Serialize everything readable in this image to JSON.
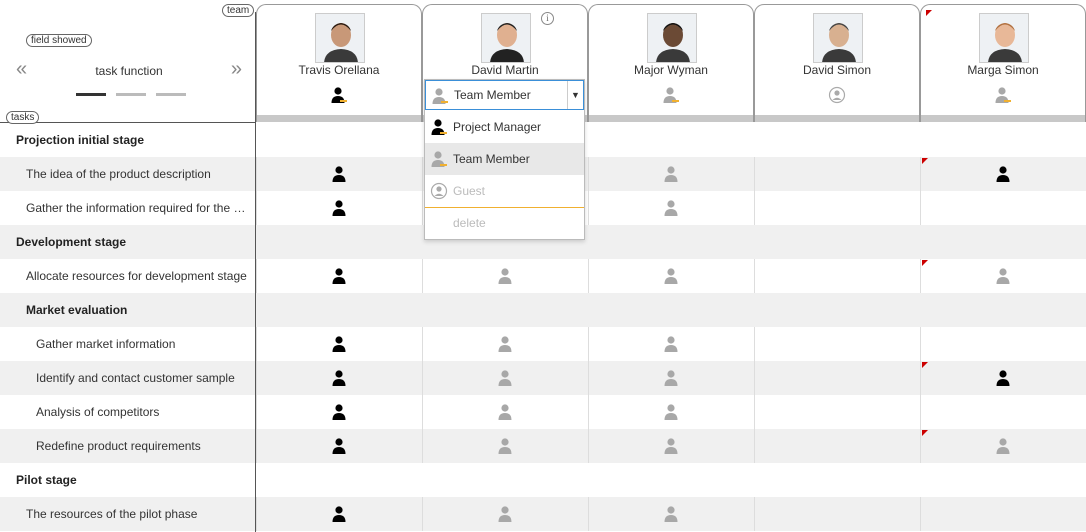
{
  "labels": {
    "team": "team",
    "tasks": "tasks",
    "field_showed": "field showed",
    "task_function": "task function",
    "prev": "«",
    "next": "»"
  },
  "colors": {
    "pm_icon": "#000000",
    "member_icon": "#a8a8a8",
    "accent_bar": "#f0b030",
    "flag": "#cc0000",
    "selected_row": "#e8e8e8",
    "dropdown_border": "#3a8fd8"
  },
  "team": [
    {
      "name": "Travis Orellana",
      "role": "member-role-icon",
      "flag": false
    },
    {
      "name": "David Martin",
      "role": "member-role-icon",
      "flag": false
    },
    {
      "name": "Major Wyman",
      "role": "member-role-icon",
      "flag": false
    },
    {
      "name": "David Simon",
      "role": "guest-role-icon",
      "flag": false
    },
    {
      "name": "Marga Simon",
      "role": "member-role-icon",
      "flag": true
    }
  ],
  "rows": [
    {
      "label": "Projection initial stage",
      "level": 0,
      "group": true,
      "cells": [
        "",
        "",
        "",
        "",
        ""
      ],
      "flag": false
    },
    {
      "label": "The idea of the product description",
      "level": 1,
      "group": false,
      "cells": [
        "pm",
        "",
        "member",
        "",
        "pm"
      ],
      "flag": true
    },
    {
      "label": "Gather the information required for the …",
      "level": 1,
      "group": false,
      "cells": [
        "pm",
        "",
        "member",
        "",
        ""
      ],
      "flag": false
    },
    {
      "label": "Development stage",
      "level": 0,
      "group": true,
      "cells": [
        "",
        "",
        "",
        "",
        ""
      ],
      "flag": false
    },
    {
      "label": "Allocate resources for development stage",
      "level": 1,
      "group": false,
      "cells": [
        "pm",
        "member",
        "member",
        "",
        "member"
      ],
      "flag": true
    },
    {
      "label": "Market evaluation",
      "level": 1,
      "group": true,
      "cells": [
        "",
        "",
        "",
        "",
        ""
      ],
      "flag": false
    },
    {
      "label": "Gather market information",
      "level": 2,
      "group": false,
      "cells": [
        "pm",
        "member",
        "member",
        "",
        ""
      ],
      "flag": false
    },
    {
      "label": "Identify and contact customer sample",
      "level": 2,
      "group": false,
      "cells": [
        "pm",
        "member",
        "member",
        "",
        "pm"
      ],
      "flag": true
    },
    {
      "label": "Analysis of competitors",
      "level": 2,
      "group": false,
      "cells": [
        "pm",
        "member",
        "member",
        "",
        ""
      ],
      "flag": false
    },
    {
      "label": "Redefine product requirements",
      "level": 2,
      "group": false,
      "cells": [
        "pm",
        "member",
        "member",
        "",
        "member"
      ],
      "flag": true
    },
    {
      "label": "Pilot stage",
      "level": 0,
      "group": true,
      "cells": [
        "",
        "",
        "",
        "",
        ""
      ],
      "flag": false
    },
    {
      "label": "The resources of the pilot phase",
      "level": 1,
      "group": false,
      "cells": [
        "pm",
        "member",
        "member",
        "",
        ""
      ],
      "flag": false
    }
  ],
  "dropdown": {
    "selected": "Team Member",
    "options": [
      {
        "label": "Project Manager",
        "icon": "pm"
      },
      {
        "label": "Team Member",
        "icon": "member"
      },
      {
        "label": "Guest",
        "icon": "guest"
      }
    ],
    "delete_label": "delete",
    "caret": "▼",
    "info": "i"
  }
}
